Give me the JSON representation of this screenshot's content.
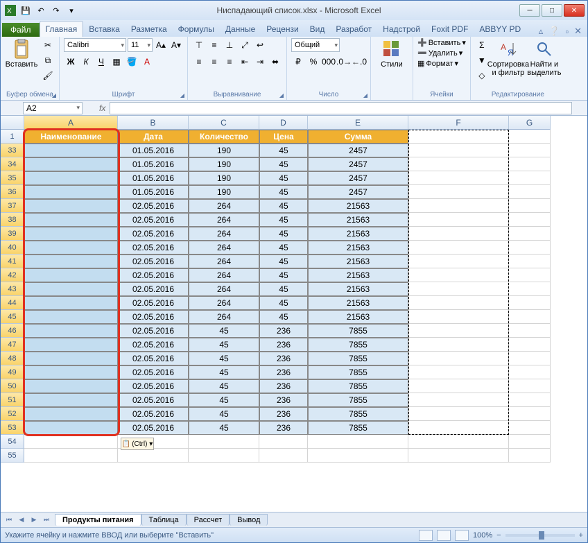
{
  "window": {
    "title": "Ниспадающий список.xlsx - Microsoft Excel"
  },
  "qat": {
    "save": "💾",
    "undo": "↶",
    "redo": "↷"
  },
  "tabs": {
    "file": "Файл",
    "items": [
      "Главная",
      "Вставка",
      "Разметка",
      "Формулы",
      "Данные",
      "Рецензи",
      "Вид",
      "Разработ",
      "Надстрой",
      "Foxit PDF",
      "ABBYY PD"
    ],
    "active_index": 0
  },
  "ribbon": {
    "clipboard": {
      "paste": "Вставить",
      "group": "Буфер обмена"
    },
    "font": {
      "name": "Calibri",
      "size": "11",
      "group": "Шрифт"
    },
    "align": {
      "group": "Выравнивание"
    },
    "number": {
      "format": "Общий",
      "group": "Число"
    },
    "styles": {
      "btn": "Стили",
      "group": ""
    },
    "cells": {
      "insert": "Вставить",
      "delete": "Удалить",
      "format": "Формат",
      "group": "Ячейки"
    },
    "editing": {
      "sort": "Сортировка и фильтр",
      "find": "Найти и выделить",
      "group": "Редактирование"
    }
  },
  "namebox": "A2",
  "fx_label": "fx",
  "columns": [
    "A",
    "B",
    "C",
    "D",
    "E",
    "F",
    "G"
  ],
  "header_row_num": "1",
  "headers": [
    "Наименование",
    "Дата",
    "Количество",
    "Цена",
    "Сумма"
  ],
  "row_nums": [
    "33",
    "34",
    "35",
    "36",
    "37",
    "38",
    "39",
    "40",
    "41",
    "42",
    "43",
    "44",
    "45",
    "46",
    "47",
    "48",
    "49",
    "50",
    "51",
    "52",
    "53",
    "54",
    "55"
  ],
  "rows": [
    {
      "b": "01.05.2016",
      "c": "190",
      "d": "45",
      "e": "2457"
    },
    {
      "b": "01.05.2016",
      "c": "190",
      "d": "45",
      "e": "2457"
    },
    {
      "b": "01.05.2016",
      "c": "190",
      "d": "45",
      "e": "2457"
    },
    {
      "b": "01.05.2016",
      "c": "190",
      "d": "45",
      "e": "2457"
    },
    {
      "b": "02.05.2016",
      "c": "264",
      "d": "45",
      "e": "21563"
    },
    {
      "b": "02.05.2016",
      "c": "264",
      "d": "45",
      "e": "21563"
    },
    {
      "b": "02.05.2016",
      "c": "264",
      "d": "45",
      "e": "21563"
    },
    {
      "b": "02.05.2016",
      "c": "264",
      "d": "45",
      "e": "21563"
    },
    {
      "b": "02.05.2016",
      "c": "264",
      "d": "45",
      "e": "21563"
    },
    {
      "b": "02.05.2016",
      "c": "264",
      "d": "45",
      "e": "21563"
    },
    {
      "b": "02.05.2016",
      "c": "264",
      "d": "45",
      "e": "21563"
    },
    {
      "b": "02.05.2016",
      "c": "264",
      "d": "45",
      "e": "21563"
    },
    {
      "b": "02.05.2016",
      "c": "264",
      "d": "45",
      "e": "21563"
    },
    {
      "b": "02.05.2016",
      "c": "45",
      "d": "236",
      "e": "7855"
    },
    {
      "b": "02.05.2016",
      "c": "45",
      "d": "236",
      "e": "7855"
    },
    {
      "b": "02.05.2016",
      "c": "45",
      "d": "236",
      "e": "7855"
    },
    {
      "b": "02.05.2016",
      "c": "45",
      "d": "236",
      "e": "7855"
    },
    {
      "b": "02.05.2016",
      "c": "45",
      "d": "236",
      "e": "7855"
    },
    {
      "b": "02.05.2016",
      "c": "45",
      "d": "236",
      "e": "7855"
    },
    {
      "b": "02.05.2016",
      "c": "45",
      "d": "236",
      "e": "7855"
    },
    {
      "b": "02.05.2016",
      "c": "45",
      "d": "236",
      "e": "7855"
    }
  ],
  "paste_options": "(Ctrl) ▾",
  "sheets": [
    "Продукты питания",
    "Таблица",
    "Рассчет",
    "Вывод"
  ],
  "active_sheet": 0,
  "status_text": "Укажите ячейку и нажмите ВВОД или выберите \"Вставить\"",
  "zoom": "100%"
}
